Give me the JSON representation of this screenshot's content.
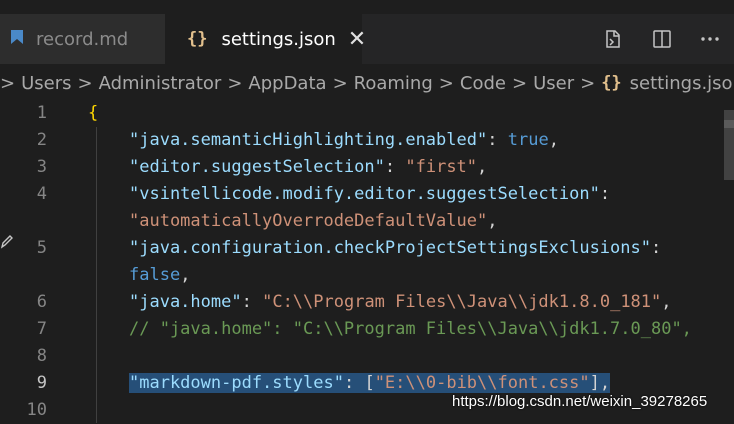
{
  "tabs": [
    {
      "label": "record.md",
      "icon": "markdown-icon",
      "active": false
    },
    {
      "label": "settings.json",
      "icon": "json-braces-icon",
      "active": true,
      "close": "✕"
    }
  ],
  "actions": [
    "open-preview-icon",
    "split-editor-icon",
    "more-actions-icon"
  ],
  "breadcrumb": {
    "lead": ">",
    "items": [
      "Users",
      "Administrator",
      "AppData",
      "Roaming",
      "Code",
      "User",
      "settings.json"
    ],
    "json_icon": "{}",
    "tail": "...",
    "separator": ">"
  },
  "lines": [
    {
      "num": "1",
      "text": "{"
    },
    {
      "num": "2",
      "text": "\"java.semanticHighlighting.enabled\": true,"
    },
    {
      "num": "3",
      "text": "\"editor.suggestSelection\": \"first\","
    },
    {
      "num": "4",
      "text": "\"vsintellicode.modify.editor.suggestSelection\":"
    },
    {
      "num": "",
      "text": "\"automaticallyOverrodeDefaultValue\","
    },
    {
      "num": "5",
      "text": "\"java.configuration.checkProjectSettingsExclusions\":"
    },
    {
      "num": "",
      "text": "false,"
    },
    {
      "num": "6",
      "text": "\"java.home\": \"C:\\\\Program Files\\\\Java\\\\jdk1.8.0_181\","
    },
    {
      "num": "7",
      "text": "// \"java.home\": \"C:\\\\Program Files\\\\Java\\\\jdk1.7.0_80\","
    },
    {
      "num": "8",
      "text": ""
    },
    {
      "num": "9",
      "text": "\"markdown-pdf.styles\": [\"E:\\\\0-bib\\\\font.css\"],"
    },
    {
      "num": "10",
      "text": ""
    }
  ],
  "watermark": "https://blog.csdn.net/weixin_39278265",
  "colors": {
    "editor_bg": "#1e1e1e",
    "selection": "#264f78",
    "key": "#9cdcfe",
    "string": "#ce9178",
    "bool": "#569cd6",
    "comment": "#6a9955"
  }
}
